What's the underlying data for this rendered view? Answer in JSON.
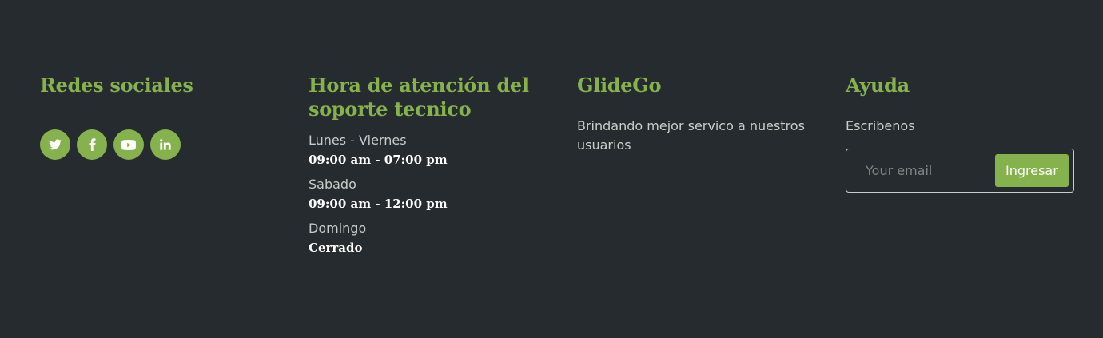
{
  "theme": {
    "background": "#252b2f",
    "accent": "#86b24d",
    "text": "#c8cdc9",
    "emphasis": "#ffffff"
  },
  "social": {
    "title": "Redes sociales",
    "icons": [
      "twitter-icon",
      "facebook-icon",
      "youtube-icon",
      "linkedin-icon"
    ]
  },
  "hours": {
    "title": "Hora de atención del soporte tecnico",
    "schedule": [
      {
        "day": "Lunes - Viernes",
        "time": "09:00 am - 07:00 pm"
      },
      {
        "day": "Sabado",
        "time": "09:00 am - 12:00 pm"
      },
      {
        "day": "Domingo",
        "time": "Cerrado"
      }
    ]
  },
  "brand": {
    "title": "GlideGo",
    "description": "Brindando mejor servico a nuestros usuarios"
  },
  "help": {
    "title": "Ayuda",
    "subtitle": "Escribenos",
    "email_placeholder": "Your email",
    "submit_label": "Ingresar"
  }
}
